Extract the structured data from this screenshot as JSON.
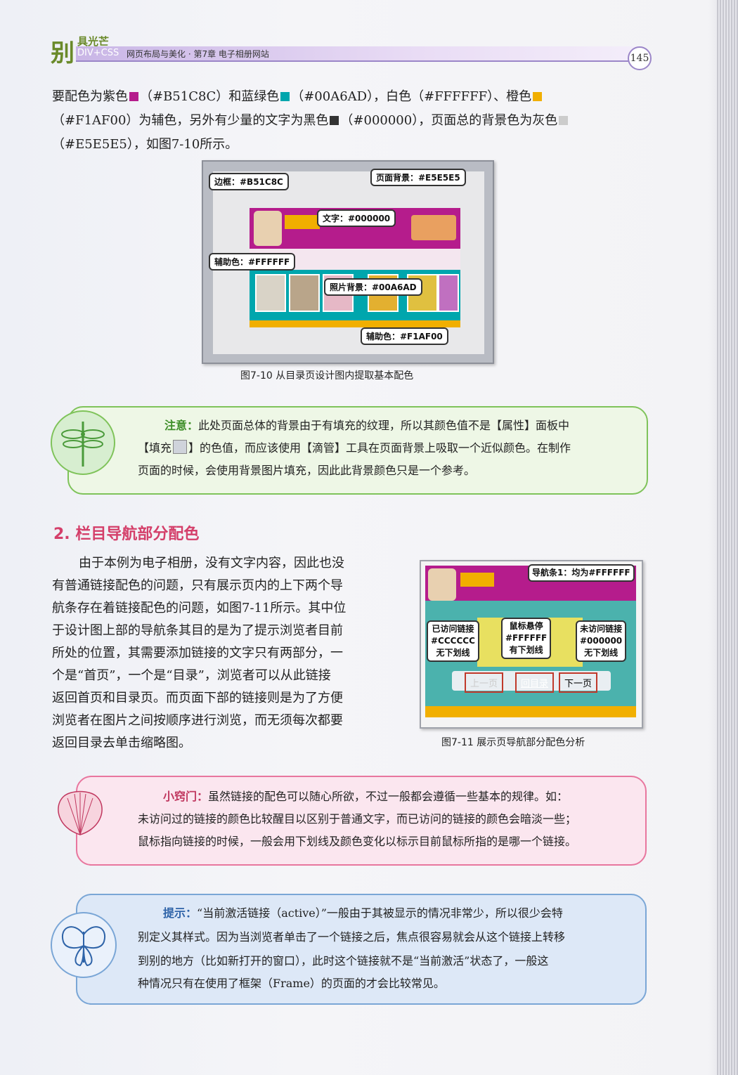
{
  "header": {
    "logo": "别",
    "brand": "具光芒",
    "series": "DIV+CSS",
    "crumb": "网页布局与美化 · 第7章    电子相册网站",
    "page_number": "145"
  },
  "colors": {
    "purple": "#B51C8C",
    "teal": "#00A6AD",
    "white": "#FFFFFF",
    "orange": "#F1AF00",
    "black": "#000000",
    "gray": "#E5E5E5"
  },
  "intro": {
    "l1a": "要配色为紫色",
    "l1b": "（#B51C8C）和蓝绿色",
    "l1c": "（#00A6AD），白色（#FFFFFF）、橙色",
    "l2a": "（#F1AF00）为辅色，另外有少量的文字为黑色",
    "l2b": "（#000000），页面总的背景色为灰色",
    "l3": "（#E5E5E5），如图7-10所示。"
  },
  "fig1": {
    "labels": {
      "border": "边框：#B51C8C",
      "page_bg": "页面背景：#E5E5E5",
      "text": "文字：#000000",
      "aux_white": "辅助色：#FFFFFF",
      "photo_bg": "照片背景：#00A6AD",
      "aux_orange": "辅助色：#F1AF00"
    },
    "caption": "图7-10   从目录页设计图内提取基本配色"
  },
  "note": {
    "lead": "注意：",
    "l1": "此处页面总体的背景由于有填充的纹理，所以其颜色值不是【属性】面板中",
    "l2": "【填充",
    "l2b": "】的色值，而应该使用【滴管】工具在页面背景上吸取一个近似颜色。在制作",
    "l3": "页面的时候，会使用背景图片填充，因此此背景颜色只是一个参考。"
  },
  "section": {
    "title": "2. 栏目导航部分配色"
  },
  "body": {
    "lines": [
      "由于本例为电子相册，没有文字内容，因此也没",
      "有普通链接配色的问题，只有展示页内的上下两个导",
      "航条存在着链接配色的问题，如图7-11所示。其中位",
      "于设计图上部的导航条其目的是为了提示浏览者目前",
      "所处的位置，其需要添加链接的文字只有两部分，一",
      "个是“首页”，一个是“目录”，浏览者可以从此链接",
      "返回首页和目录页。而页面下部的链接则是为了方便",
      "浏览者在图片之间按顺序进行浏览，而无须每次都要",
      "返回目录去单击缩略图。"
    ]
  },
  "fig2": {
    "nav_label": "导航条1：均为#FFFFFF",
    "visited": {
      "l1": "已访问链接",
      "l2": "#CCCCCC",
      "l3": "无下划线"
    },
    "hover": {
      "l1": "鼠标悬停",
      "l2": "#FFFFFF",
      "l3": "有下划线"
    },
    "unvisited": {
      "l1": "未访问链接",
      "l2": "#000000",
      "l3": "无下划线"
    },
    "btn_prev": "上一页",
    "btn_catalog": "回目录",
    "btn_next": "下一页",
    "caption": "图7-11   展示页导航部分配色分析"
  },
  "tip1": {
    "lead": "小窍门：",
    "l1": "虽然链接的配色可以随心所欲，不过一般都会遵循一些基本的规律。如：",
    "l2": "未访问过的链接的颜色比较醒目以区别于普通文字，而已访问的链接的颜色会暗淡一些；",
    "l3": "鼠标指向链接的时候，一般会用下划线及颜色变化以标示目前鼠标所指的是哪一个链接。"
  },
  "tip2": {
    "lead": "提示：",
    "l1": "“当前激活链接（active）”一般由于其被显示的情况非常少，所以很少会特",
    "l2": "别定义其样式。因为当浏览者单击了一个链接之后，焦点很容易就会从这个链接上转移",
    "l3": "到别的地方（比如新打开的窗口），此时这个链接就不是“当前激活”状态了，一般这",
    "l4": "种情况只有在使用了框架（Frame）的页面的才会比较常见。"
  }
}
